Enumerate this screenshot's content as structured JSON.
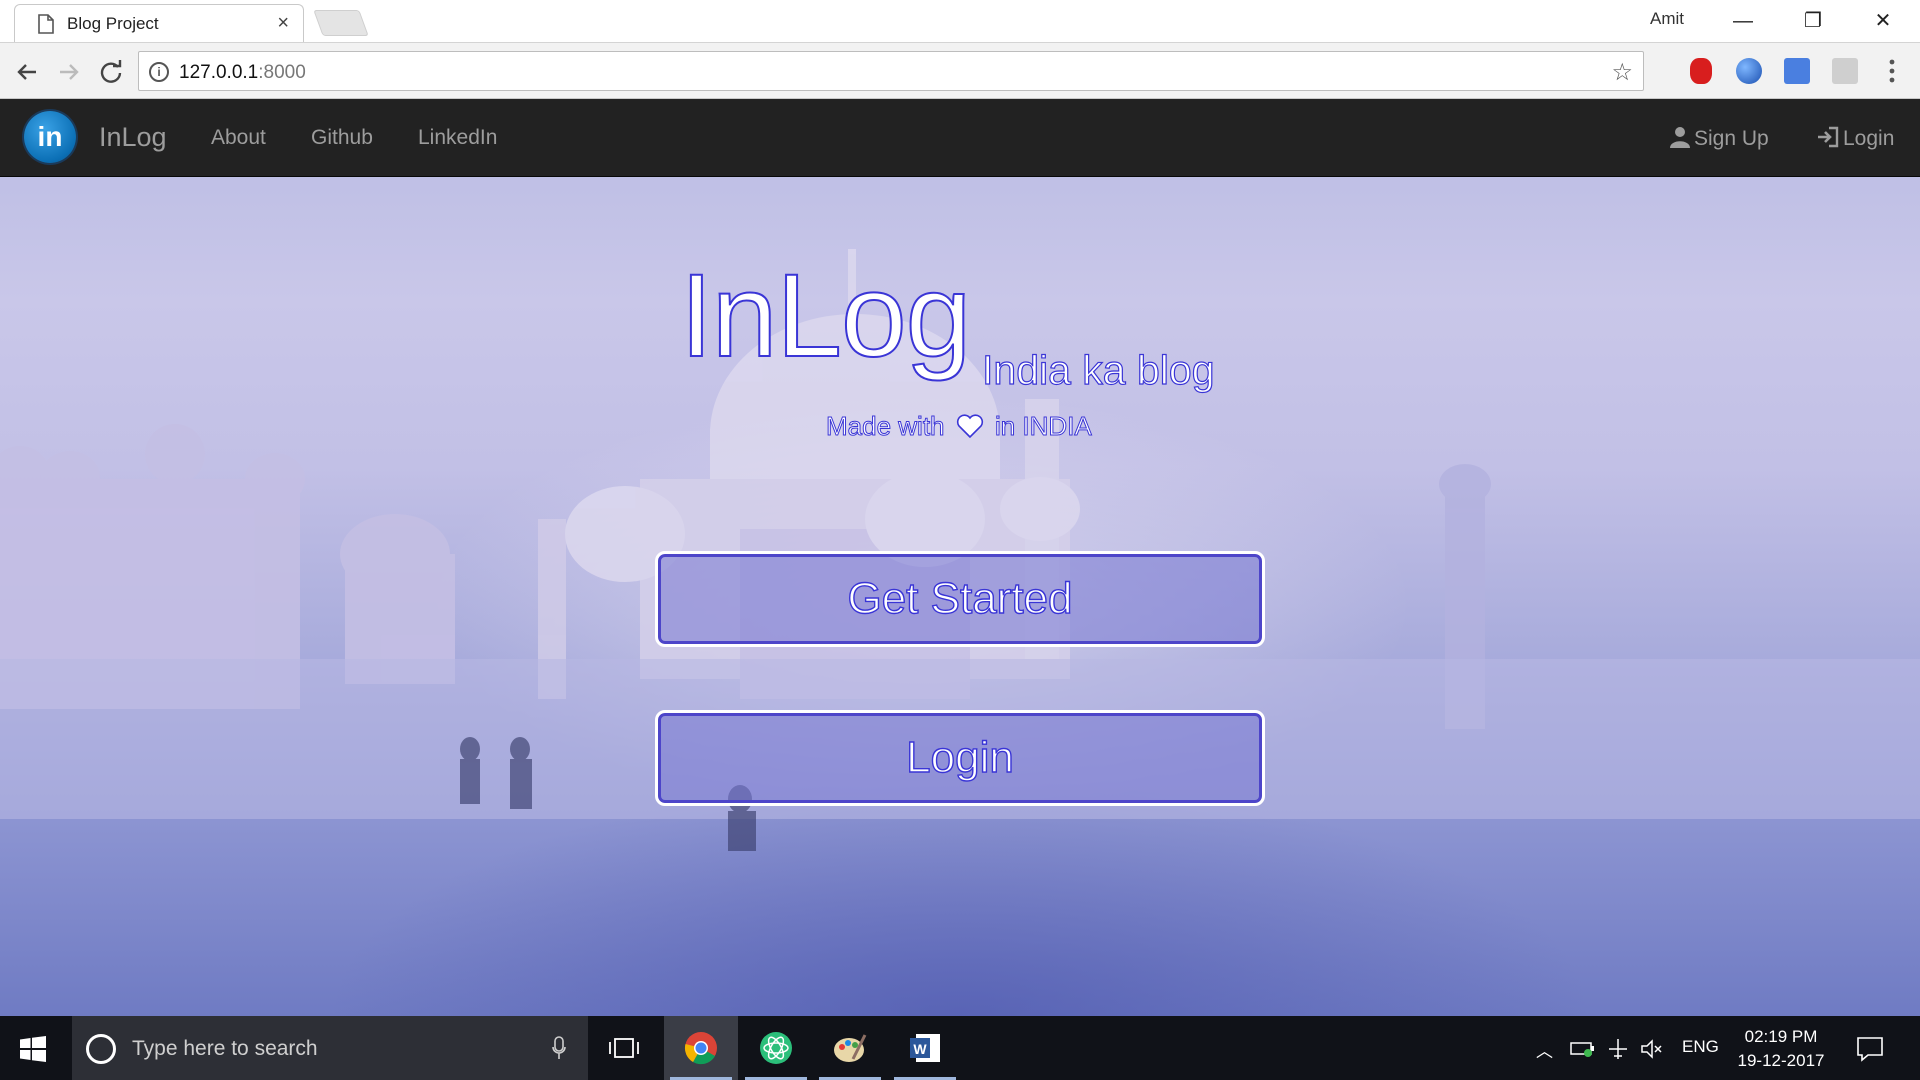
{
  "browser": {
    "tab_title": "Blog Project",
    "tab_close": "×",
    "profile_name": "Amit",
    "url_host": "127.0.0.1",
    "url_port": ":8000",
    "window_controls": {
      "minimize": "—",
      "restore": "❐",
      "close": "✕"
    }
  },
  "navbar": {
    "logo_text": "in",
    "brand": "InLog",
    "links": [
      "About",
      "Github",
      "LinkedIn"
    ],
    "signup": "Sign Up",
    "login": "Login"
  },
  "hero": {
    "title": "InLog",
    "subtitle": "India ka blog",
    "tagline_before": "Made with",
    "tagline_after": "in INDIA",
    "get_started": "Get Started",
    "login": "Login"
  },
  "taskbar": {
    "search_placeholder": "Type here to search",
    "language": "ENG",
    "time": "02:19 PM",
    "date": "19-12-2017"
  },
  "colors": {
    "navbar_bg": "#222222",
    "nav_text": "#9d9d9d",
    "hero_outline": "#3a35d6",
    "taskbar_bg": "#101218"
  },
  "icons": [
    "page-icon",
    "back-arrow-icon",
    "forward-arrow-icon",
    "reload-icon",
    "info-icon",
    "star-icon",
    "user-icon",
    "login-icon",
    "heart-icon",
    "windows-start-icon",
    "cortana-icon",
    "microphone-icon",
    "task-view-icon",
    "chrome-icon",
    "atom-icon",
    "paint-icon",
    "word-icon",
    "chevron-up-icon",
    "battery-icon",
    "airplane-icon",
    "volume-mute-icon",
    "notifications-icon"
  ]
}
